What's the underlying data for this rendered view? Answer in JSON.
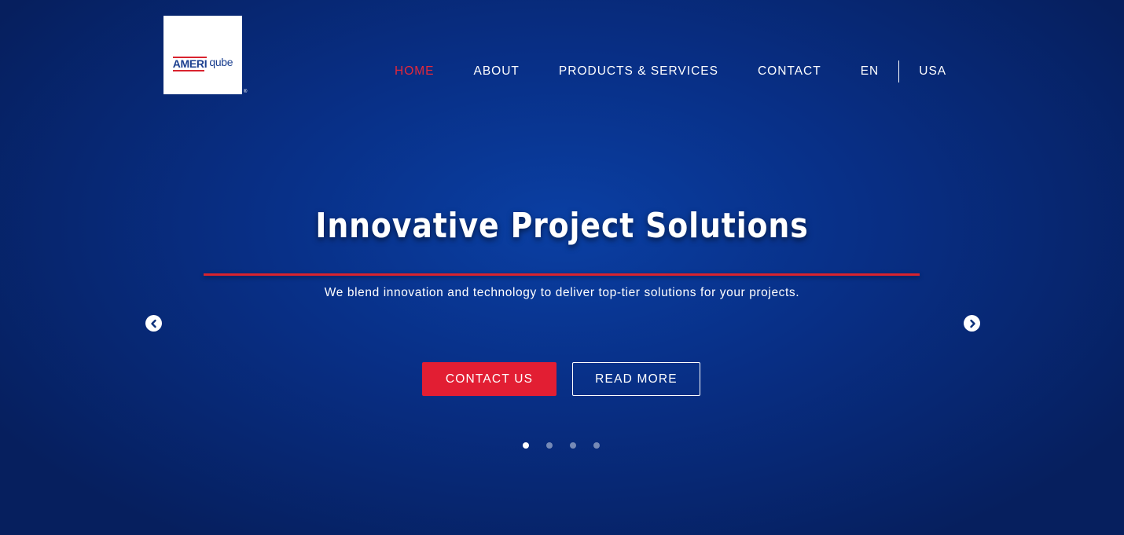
{
  "logo": {
    "text_part1": "AMERI",
    "text_part2": "qube",
    "registered_mark": "®"
  },
  "nav": {
    "items": [
      {
        "label": "HOME",
        "active": true
      },
      {
        "label": "ABOUT",
        "active": false
      },
      {
        "label": "PRODUCTS & SERVICES",
        "active": false
      },
      {
        "label": "CONTACT",
        "active": false
      }
    ],
    "language": "EN",
    "region": "USA"
  },
  "hero": {
    "headline": "Innovative Project Solutions",
    "subtitle": "We blend innovation and technology to deliver top-tier solutions for your projects.",
    "primary_button": "CONTACT US",
    "secondary_button": "READ MORE",
    "prev_icon": "chevron-left-circle-icon",
    "next_icon": "chevron-right-circle-icon",
    "slide_count": 4,
    "active_slide": 1
  },
  "colors": {
    "accent_red": "#e21e33",
    "brand_blue": "#082f86",
    "active_nav": "#e5283a"
  }
}
